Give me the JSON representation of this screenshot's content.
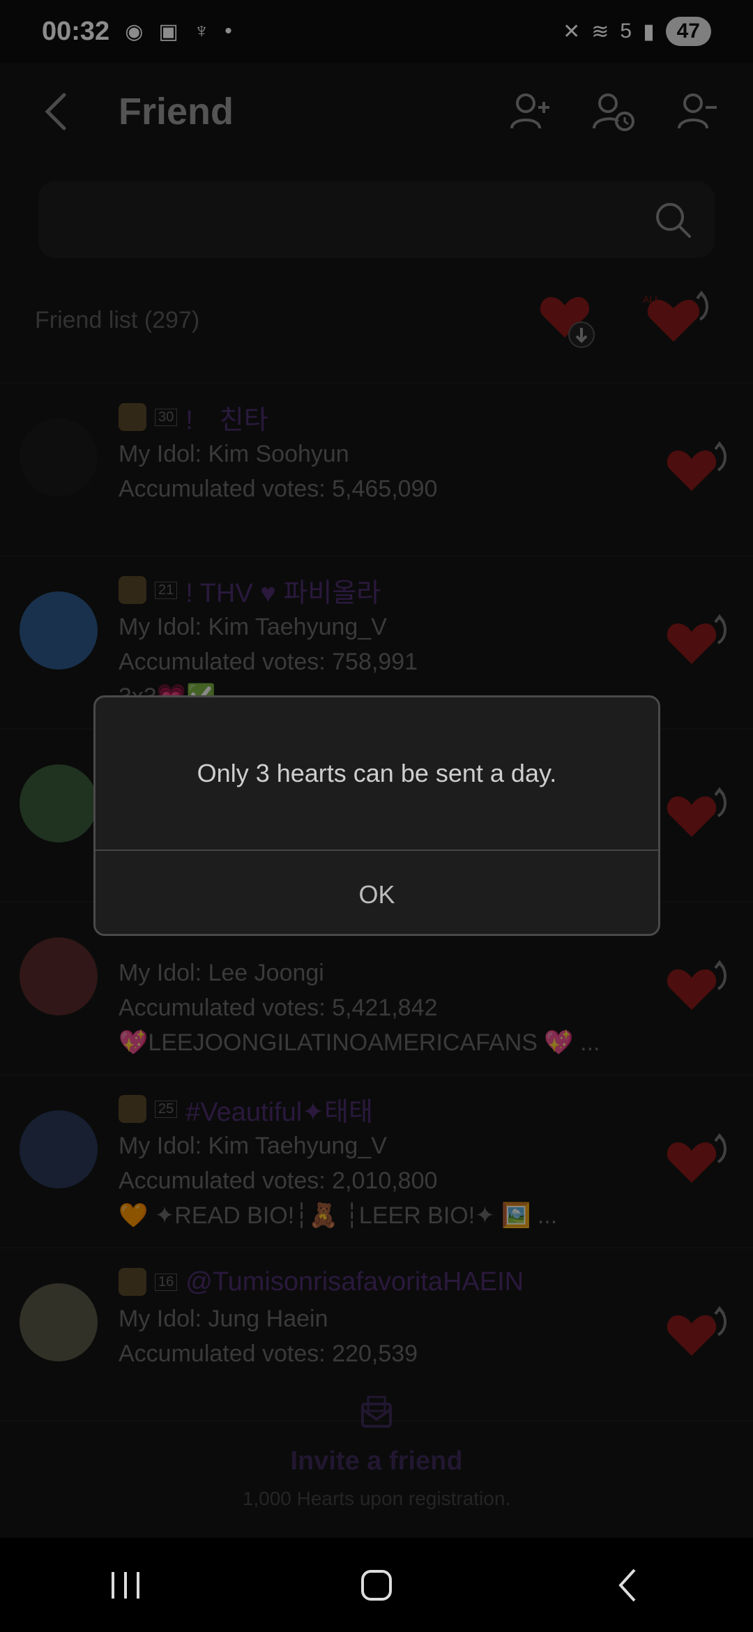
{
  "status_bar": {
    "time": "00:32",
    "battery": "47",
    "network": "5"
  },
  "header": {
    "title": "Friend"
  },
  "search": {
    "placeholder": ""
  },
  "friend_list": {
    "label": "Friend list (297)"
  },
  "friends": [
    {
      "level": "30",
      "nickname": "!　친타",
      "idol": "My Idol: Kim Soohyun",
      "votes": "Accumulated votes: 5,465,090",
      "bio": "",
      "avatar_color": "#1a1a1a"
    },
    {
      "level": "21",
      "nickname": "! THV ♥ 파비올라",
      "idol": "My Idol: Kim Taehyung_V",
      "votes": "Accumulated votes: 758,991",
      "bio": "3x3💗✅ ...",
      "avatar_color": "#2e5a8a"
    },
    {
      "level": "",
      "nickname": "",
      "idol": "",
      "votes": "",
      "bio": "",
      "avatar_color": "#3b5b3b"
    },
    {
      "level": "",
      "nickname": "",
      "idol": "My Idol: Lee Joongi",
      "votes": "Accumulated votes: 5,421,842",
      "bio": "💖LEEJOONGILATINOAMERICAFANS 💖 ...",
      "avatar_color": "#5a2a2a"
    },
    {
      "level": "25",
      "nickname": "#Veautiful✦태태",
      "idol": "My Idol: Kim Taehyung_V",
      "votes": "Accumulated votes: 2,010,800",
      "bio": "🧡 ✦READ BIO!┆🧸 ┆LEER BIO!✦ 🖼️  ...",
      "avatar_color": "#2a3a5a"
    },
    {
      "level": "16",
      "nickname": "@TumisonrisafavoritaHAEIN",
      "idol": "My Idol: Jung Haein",
      "votes": "Accumulated votes: 220,539",
      "bio": "",
      "avatar_color": "#5a5a4a"
    }
  ],
  "invite": {
    "title": "Invite a friend",
    "subtitle": "1,000 Hearts upon registration."
  },
  "modal": {
    "message": "Only 3 hearts can be sent a day.",
    "ok_label": "OK"
  },
  "colors": {
    "heart": "#8b1a1a",
    "accent": "#4e2f70"
  }
}
